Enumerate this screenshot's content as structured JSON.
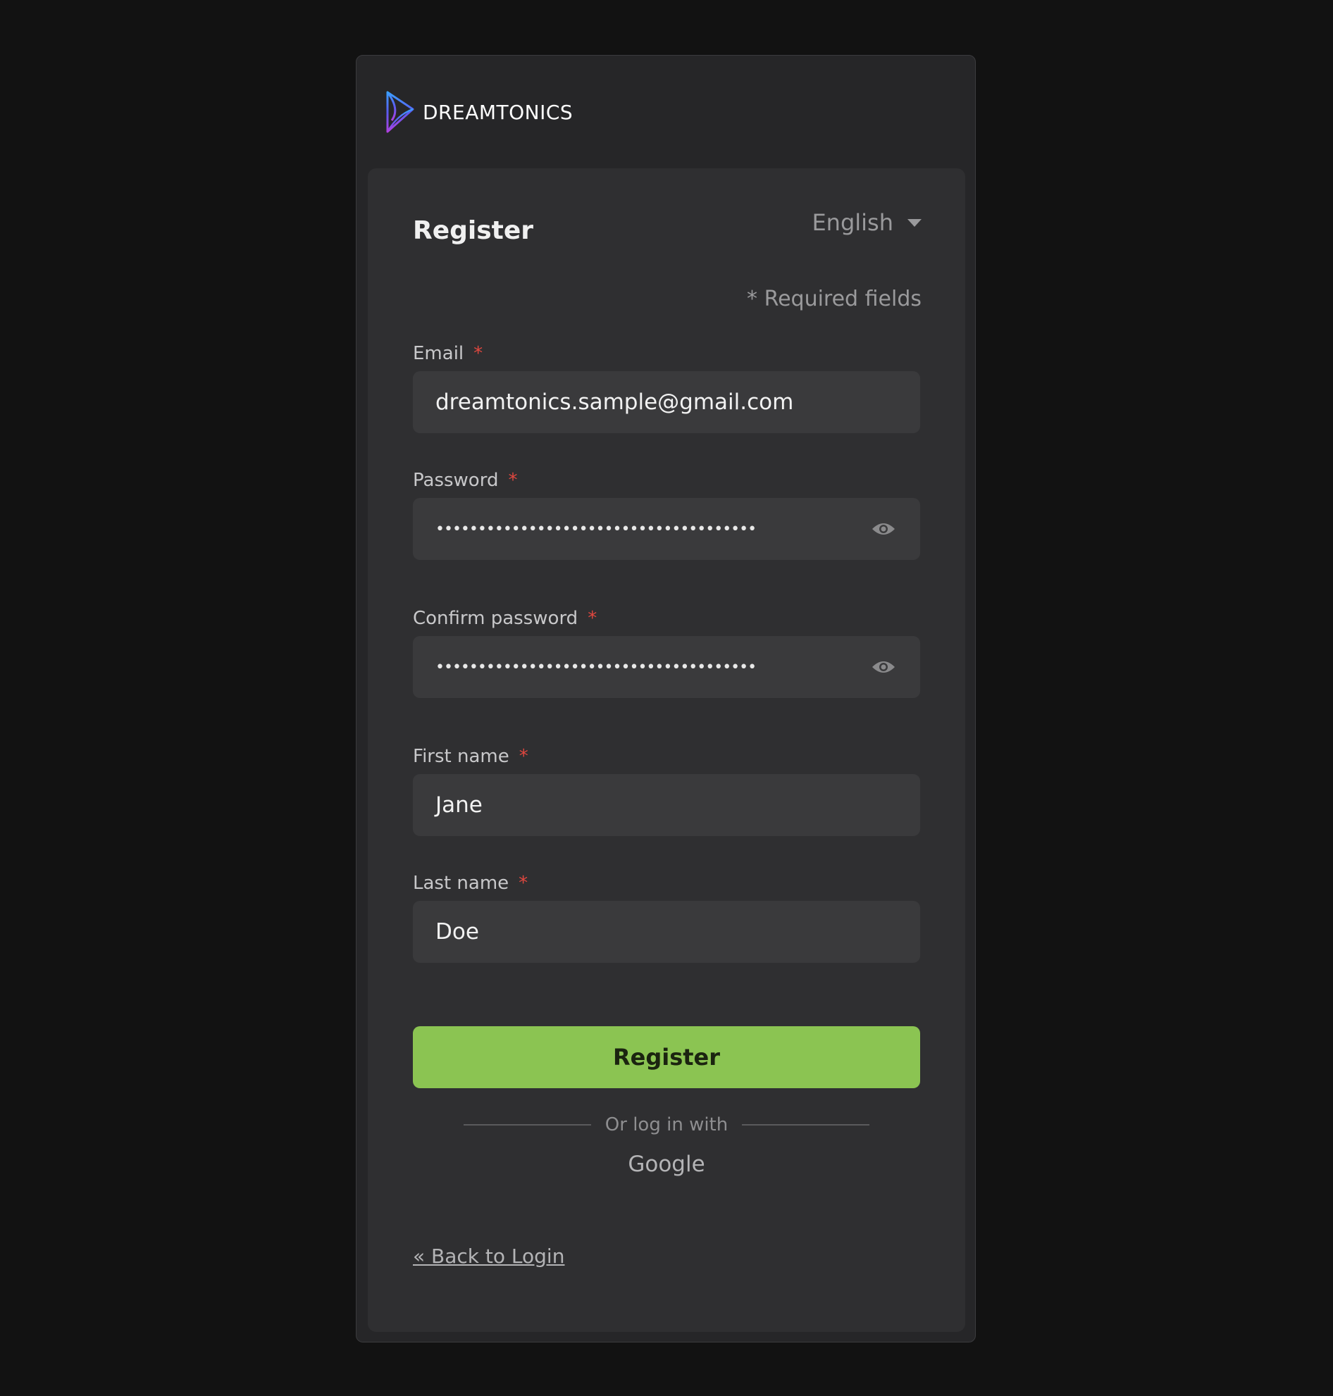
{
  "brand": {
    "name": "DREAMTONICS",
    "logo_icon": "dreamtonics-logo-icon"
  },
  "form": {
    "title": "Register",
    "language": {
      "selected": "English",
      "icon": "chevron-down-icon"
    },
    "required_note": "* Required fields",
    "fields": {
      "email": {
        "label": "Email",
        "required_mark": "*",
        "value": "dreamtonics.sample@gmail.com"
      },
      "password": {
        "label": "Password",
        "required_mark": "*",
        "value": "••••••••••••••••••••••••••••••••••••••",
        "icon": "eye-icon"
      },
      "confirm_password": {
        "label": "Confirm password",
        "required_mark": "*",
        "value": "••••••••••••••••••••••••••••••••••••••",
        "icon": "eye-icon"
      },
      "first_name": {
        "label": "First name",
        "required_mark": "*",
        "value": "Jane"
      },
      "last_name": {
        "label": "Last name",
        "required_mark": "*",
        "value": "Doe"
      }
    },
    "submit_label": "Register",
    "divider_text": "Or log in with",
    "social_login": "Google",
    "back_link": "« Back to Login"
  },
  "colors": {
    "background": "#121212",
    "card": "#262628",
    "panel": "#2f2f31",
    "input": "#3a3a3c",
    "accent": "#8bc452",
    "required": "#e0473f"
  }
}
